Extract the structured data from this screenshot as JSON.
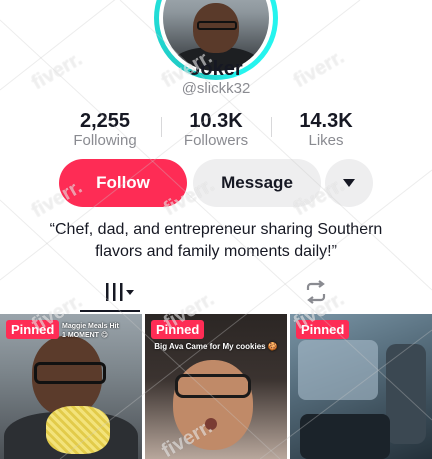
{
  "profile": {
    "display_name": "Joker",
    "username": "@slickk32",
    "bio": "“Chef, dad, and entrepreneur sharing Southern flavors and family moments daily!”"
  },
  "stats": {
    "following": {
      "value": "2,255",
      "label": "Following"
    },
    "followers": {
      "value": "10.3K",
      "label": "Followers"
    },
    "likes": {
      "value": "14.3K",
      "label": "Likes"
    }
  },
  "actions": {
    "follow_label": "Follow",
    "message_label": "Message",
    "more_icon": "caret-down-icon"
  },
  "tabs": [
    {
      "name": "videos",
      "icon": "grid-columns-icon",
      "active": true
    },
    {
      "name": "reposts",
      "icon": "repost-icon",
      "active": false
    }
  ],
  "videos": [
    {
      "badge": "Pinned",
      "caption": "Maggie Meals Hit\n1 MOMENT 😋"
    },
    {
      "badge": "Pinned",
      "caption": "Big Ava Came for My cookies 🍪"
    },
    {
      "badge": "Pinned",
      "caption": ""
    }
  ],
  "watermark_text": "fiverr.",
  "colors": {
    "accent": "#fe2c55",
    "ring": "#25f4ee",
    "secondary_text": "#8a8b91",
    "button_gray": "#eeeeef"
  }
}
